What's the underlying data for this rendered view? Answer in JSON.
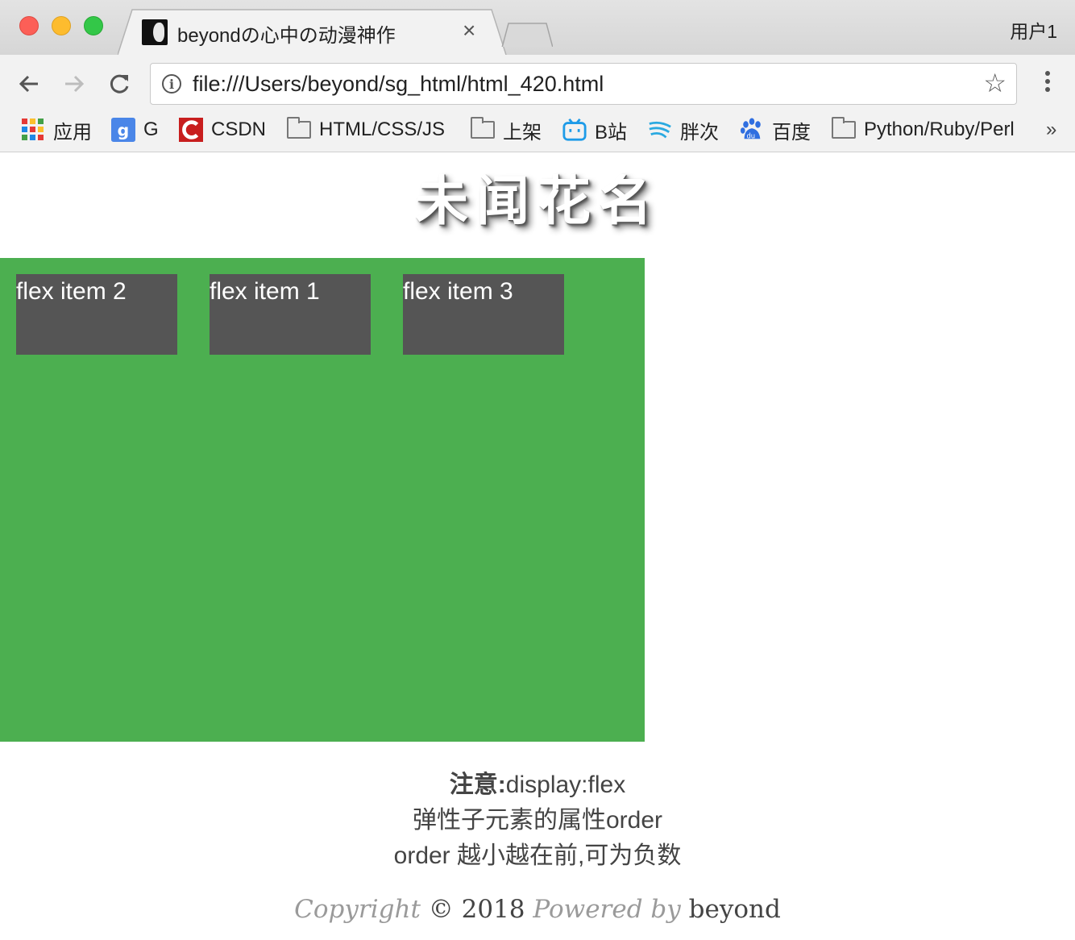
{
  "window": {
    "tab_title": "beyondの心中の动漫神作",
    "tab_close": "×",
    "user": "用户1"
  },
  "toolbar": {
    "url": "file:///Users/beyond/sg_html/html_420.html",
    "info_icon": "i",
    "star_icon": "☆"
  },
  "bookmarks": {
    "items": [
      {
        "label": "应用",
        "icon": "apps-grid-icon"
      },
      {
        "label": "G",
        "icon": "google-icon"
      },
      {
        "label": "CSDN",
        "icon": "csdn-icon"
      },
      {
        "label": "HTML/CSS/JS",
        "icon": "folder-icon"
      },
      {
        "label": "上架",
        "icon": "folder-icon"
      },
      {
        "label": "B站",
        "icon": "bilibili-icon"
      },
      {
        "label": "胖次",
        "icon": "wave-icon"
      },
      {
        "label": "百度",
        "icon": "baidu-paw-icon"
      },
      {
        "label": "Python/Ruby/Perl",
        "icon": "folder-icon"
      }
    ],
    "more": "»"
  },
  "page": {
    "heading": "未闻花名",
    "flex_items": [
      "flex item 2",
      "flex item 1",
      "flex item 3"
    ],
    "container_color": "#4caf50",
    "item_color": "#555555",
    "notes": {
      "label": "注意:",
      "line1": "display:flex",
      "line2": "弹性子元素的属性order",
      "line3": "order 越小越在前,可为负数"
    },
    "footer": {
      "copyright_word": "Copyright",
      "symbol_year": "© 2018",
      "powered_by": "Powered by",
      "author": "beyond"
    }
  }
}
